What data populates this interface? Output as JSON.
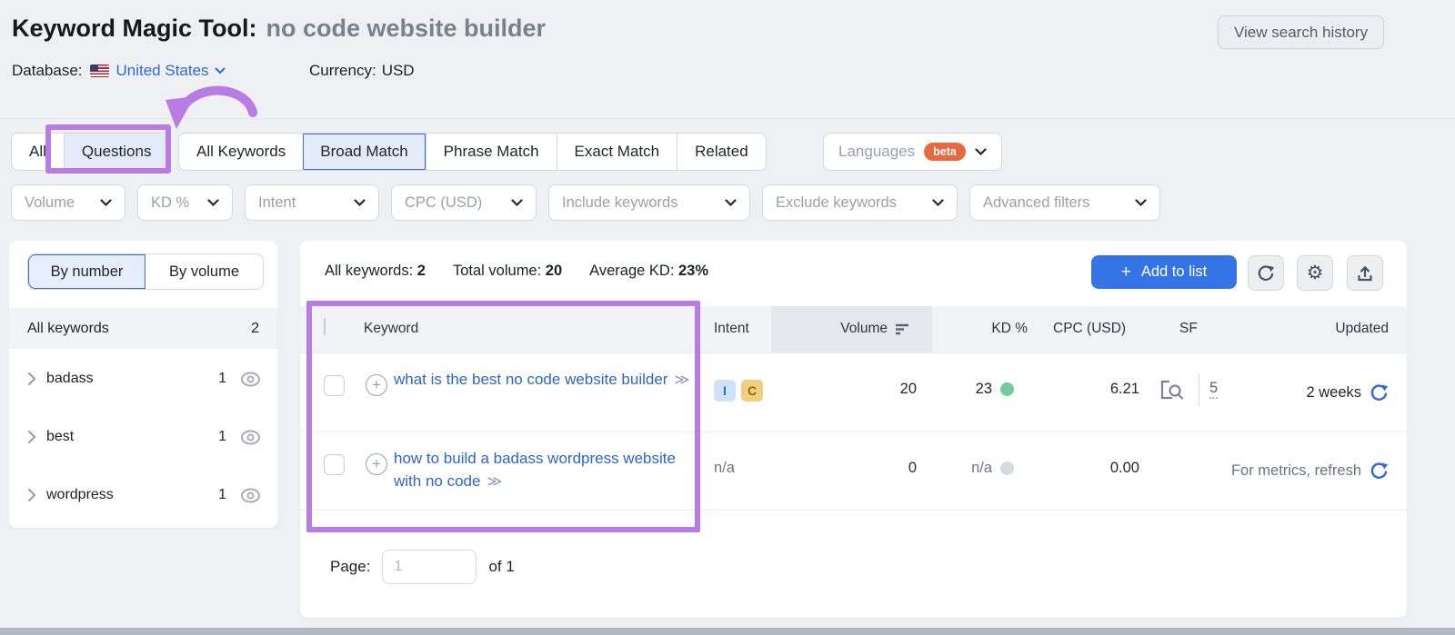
{
  "header": {
    "title": "Keyword Magic Tool:",
    "query": "no code website builder",
    "view_search_history": "View search history",
    "database_label": "Database:",
    "database_value": "United States",
    "currency_label": "Currency:",
    "currency_value": "USD"
  },
  "tabs": {
    "group1": [
      {
        "label": "All"
      },
      {
        "label": "Questions"
      }
    ],
    "group2": [
      {
        "label": "All Keywords"
      },
      {
        "label": "Broad Match"
      },
      {
        "label": "Phrase Match"
      },
      {
        "label": "Exact Match"
      },
      {
        "label": "Related"
      }
    ],
    "active_tab": "Broad Match",
    "languages": {
      "label": "Languages",
      "badge": "beta"
    }
  },
  "filters": [
    {
      "label": "Volume"
    },
    {
      "label": "KD %"
    },
    {
      "label": "Intent"
    },
    {
      "label": "CPC (USD)"
    },
    {
      "label": "Include keywords"
    },
    {
      "label": "Exclude keywords"
    },
    {
      "label": "Advanced filters"
    }
  ],
  "sidebar": {
    "toggle": {
      "by_number": "By number",
      "by_volume": "By volume",
      "active": "By number"
    },
    "all_row": {
      "label": "All keywords",
      "count": "2"
    },
    "groups": [
      {
        "label": "badass",
        "count": "1"
      },
      {
        "label": "best",
        "count": "1"
      },
      {
        "label": "wordpress",
        "count": "1"
      }
    ]
  },
  "summary": {
    "all_keywords_label": "All keywords:",
    "all_keywords_value": "2",
    "total_volume_label": "Total volume:",
    "total_volume_value": "20",
    "avg_kd_label": "Average KD:",
    "avg_kd_value": "23%",
    "add_to_list_plus": "+",
    "add_to_list_label": "Add to list"
  },
  "table": {
    "columns": {
      "keyword": "Keyword",
      "intent": "Intent",
      "volume": "Volume",
      "kd": "KD %",
      "cpc": "CPC (USD)",
      "sf": "SF",
      "updated": "Updated"
    },
    "rows": [
      {
        "keyword": "what is the best no code website builder",
        "intents": [
          "I",
          "C"
        ],
        "volume": "20",
        "kd": "23",
        "cpc": "6.21",
        "sf": "5",
        "updated": "2 weeks"
      },
      {
        "keyword": "how to build a badass wordpress website with no code",
        "intent_na": "n/a",
        "volume": "0",
        "kd": "n/a",
        "cpc": "0.00",
        "updated": "For metrics, refresh"
      }
    ]
  },
  "pagination": {
    "label": "Page:",
    "value": "1",
    "of": "of 1"
  },
  "annotations": {
    "double_chevron": "≫",
    "gear_glyph": "⚙"
  },
  "colors": {
    "annotation_purple": "#b87ce4",
    "link_blue": "#2c66c9",
    "button_blue": "#3474e4",
    "kd_green_dot": "#72cb99",
    "kd_gray_dot": "#d7dae0",
    "beta_orange": "#e8693f",
    "intent_i_bg": "#cfe3f8",
    "intent_c_bg": "#f0d080",
    "header_row_bg": "#f2f3f7",
    "volume_col_bg": "#e4e7ee"
  }
}
